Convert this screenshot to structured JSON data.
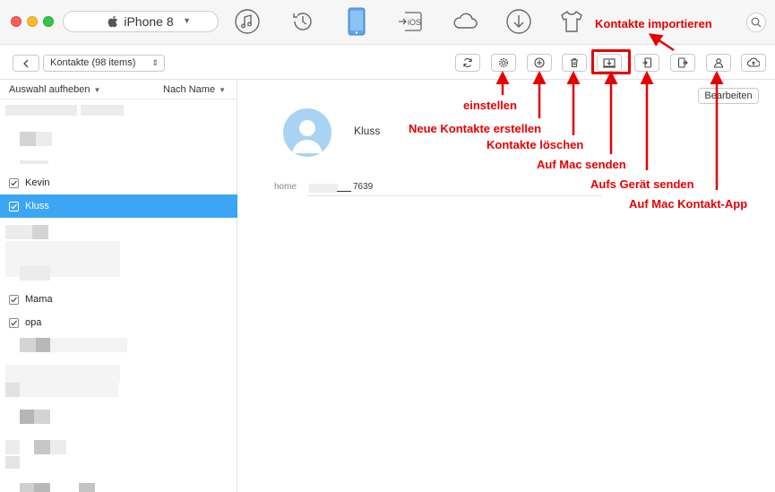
{
  "titlebar": {
    "device_name": "iPhone 8",
    "icons": [
      "music-icon",
      "history-icon",
      "device-icon",
      "ios-transfer-icon",
      "cloud-icon",
      "download-icon",
      "tshirt-icon"
    ],
    "ios_label": "iOS"
  },
  "toolbar": {
    "contacts_select": "Kontakte (98 items)",
    "buttons": [
      "refresh-icon",
      "settings-icon",
      "add-icon",
      "delete-icon",
      "send-to-mac-icon",
      "send-to-device-icon",
      "export-icon",
      "contact-app-icon",
      "cloud-upload-icon"
    ]
  },
  "sidebar": {
    "deselect_label": "Auswahl aufheben",
    "sort_label": "Nach Name",
    "contacts": [
      {
        "name": "Kevin",
        "checked": true,
        "selected": false
      },
      {
        "name": "Kluss",
        "checked": true,
        "selected": true
      },
      {
        "name": "Mama",
        "checked": true,
        "selected": false
      },
      {
        "name": "opa",
        "checked": true,
        "selected": false
      }
    ]
  },
  "detail": {
    "name": "Kluss",
    "edit_label": "Bearbeiten",
    "field_label": "home",
    "field_value": "7639"
  },
  "annotations": {
    "import": "Kontakte importieren",
    "settings": "einstellen",
    "new": "Neue Kontakte erstellen",
    "delete": "Kontakte löschen",
    "to_mac": "Auf Mac senden",
    "to_device": "Aufs Gerät senden",
    "to_contact_app": "Auf Mac Kontakt-App"
  },
  "colors": {
    "selection": "#3ba6f3",
    "annotation": "#e60000",
    "avatar": "#a9d3f3"
  }
}
